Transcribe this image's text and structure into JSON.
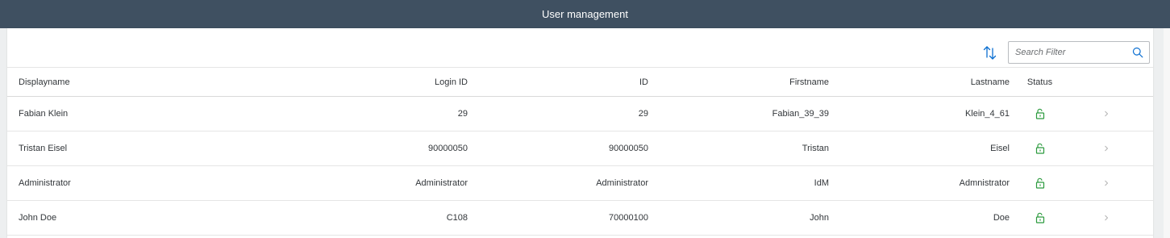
{
  "header": {
    "title": "User management"
  },
  "toolbar": {
    "sort_icon": "sort-ascending-descending-icon",
    "search": {
      "placeholder": "Search Filter",
      "value": "",
      "icon": "search-icon"
    }
  },
  "table": {
    "columns": {
      "displayname": "Displayname",
      "login_id": "Login ID",
      "id": "ID",
      "firstname": "Firstname",
      "lastname": "Lastname",
      "status": "Status"
    },
    "rows": [
      {
        "displayname": "Fabian Klein",
        "login_id": "29",
        "id": "29",
        "firstname": "Fabian_39_39",
        "lastname": "Klein_4_61",
        "status_icon": "unlocked-icon"
      },
      {
        "displayname": "Tristan Eisel",
        "login_id": "90000050",
        "id": "90000050",
        "firstname": "Tristan",
        "lastname": "Eisel",
        "status_icon": "unlocked-icon"
      },
      {
        "displayname": "Administrator",
        "login_id": "Administrator",
        "id": "Administrator",
        "firstname": "IdM",
        "lastname": "Admnistrator",
        "status_icon": "unlocked-icon"
      },
      {
        "displayname": "John Doe",
        "login_id": "C108",
        "id": "70000100",
        "firstname": "John",
        "lastname": "Doe",
        "status_icon": "unlocked-icon"
      }
    ]
  },
  "colors": {
    "shellbar": "#3f5061",
    "background": "#edeff0",
    "status_ok": "#2b9a3d",
    "link": "#0a6ed1",
    "nav_chevron": "#b3b3b3"
  }
}
